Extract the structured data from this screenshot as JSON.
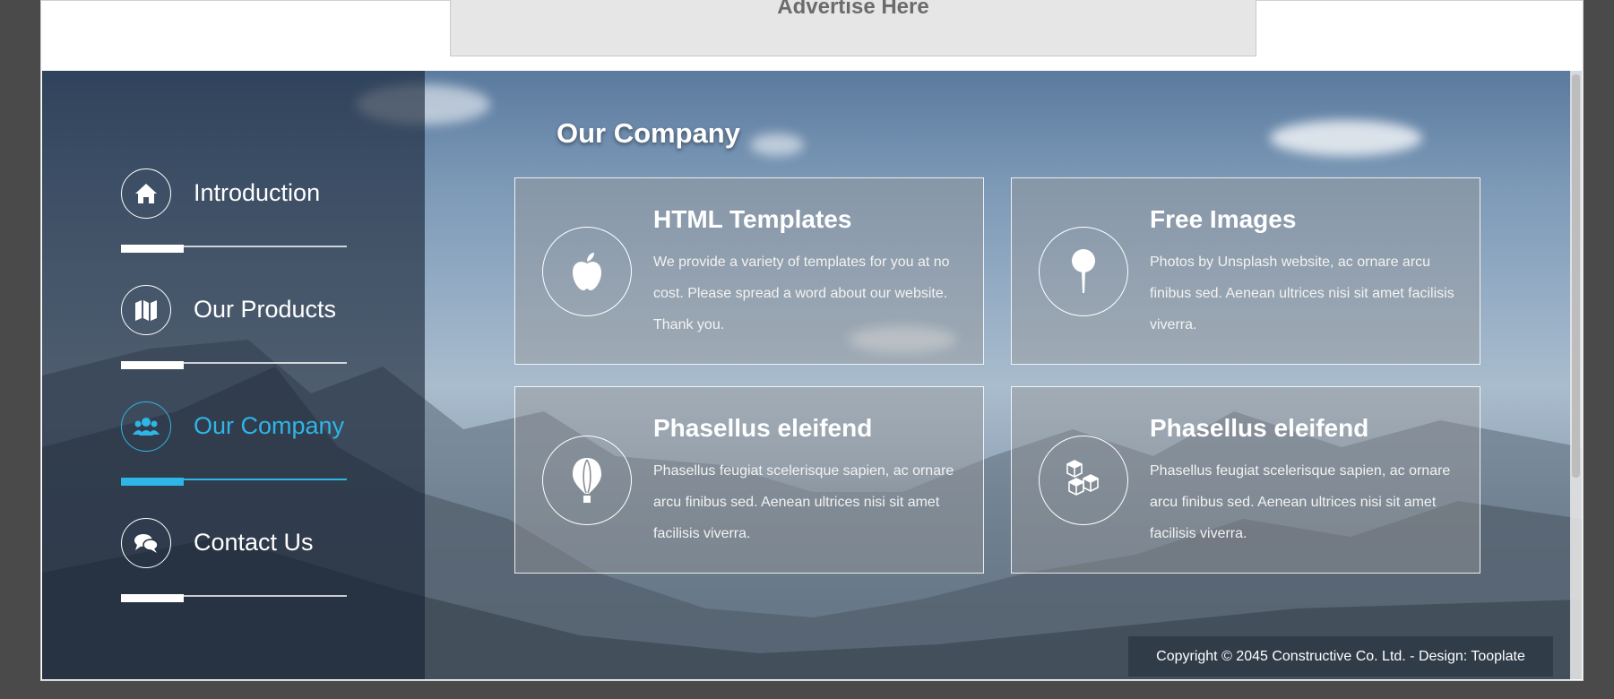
{
  "ad": {
    "label": "Advertise Here"
  },
  "nav": {
    "items": [
      {
        "label": "Introduction",
        "icon": "home-icon",
        "active": false
      },
      {
        "label": "Our Products",
        "icon": "map-icon",
        "active": false
      },
      {
        "label": "Our Company",
        "icon": "users-icon",
        "active": true
      },
      {
        "label": "Contact Us",
        "icon": "comments-icon",
        "active": false
      }
    ],
    "accent_color": "#2fb5e6"
  },
  "main": {
    "title": "Our Company",
    "cards": [
      {
        "title": "HTML Templates",
        "text": "We provide a variety of templates for you at no cost. Please spread a word about our website. Thank you.",
        "icon": "apple-icon"
      },
      {
        "title": "Free Images",
        "text": "Photos by Unsplash website, ac ornare arcu finibus sed. Aenean ultrices nisi sit amet facilisis viverra.",
        "icon": "pushpin-icon"
      },
      {
        "title": "Phasellus eleifend",
        "text": "Phasellus feugiat scelerisque sapien, ac ornare arcu finibus sed. Aenean ultrices nisi sit amet facilisis viverra.",
        "icon": "balloon-icon"
      },
      {
        "title": "Phasellus eleifend",
        "text": "Phasellus feugiat scelerisque sapien, ac ornare arcu finibus sed. Aenean ultrices nisi sit amet facilisis viverra.",
        "icon": "cubes-icon"
      }
    ]
  },
  "footer": {
    "copyright": "Copyright © 2045 Constructive Co. Ltd. - Design: Tooplate"
  }
}
